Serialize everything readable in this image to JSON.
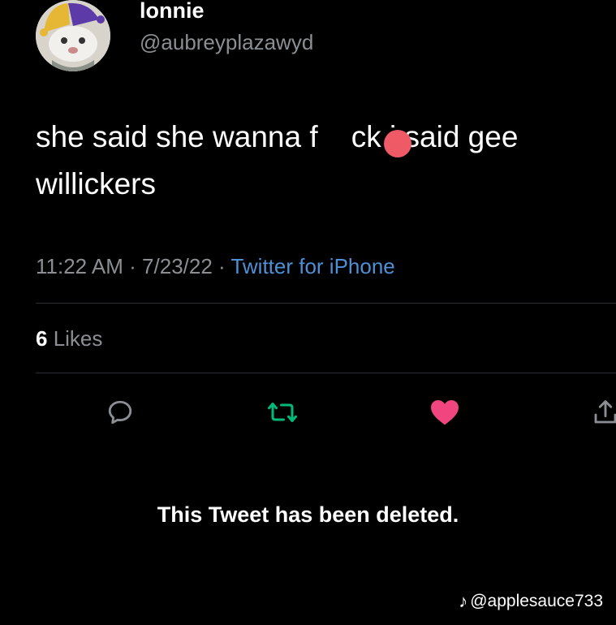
{
  "user": {
    "display_name": "lonnie",
    "handle": "@aubreyplazawyd",
    "avatar_icon": "jester-avatar-icon"
  },
  "tweet": {
    "line1": "she said she wanna f    ck i said gee",
    "line2": "willickers",
    "time": "11:22 AM",
    "separator": " · ",
    "date": "7/23/22",
    "source": "Twitter for iPhone"
  },
  "stats": {
    "likes_count": "6",
    "likes_label": " Likes"
  },
  "actions": {
    "reply_icon": "reply-icon",
    "retweet_icon": "retweet-icon",
    "like_icon": "heart-icon",
    "share_icon": "share-icon"
  },
  "colors": {
    "background": "#000000",
    "secondary_text": "#8b8f94",
    "link": "#4f8fd6",
    "retweet": "#00ba7c",
    "like": "#f0457f",
    "censor_dot": "#ee5a66"
  },
  "deleted_notice": "This Tweet has been deleted.",
  "watermark": {
    "logo_icon": "tiktok-icon",
    "handle": "@applesauce733"
  }
}
